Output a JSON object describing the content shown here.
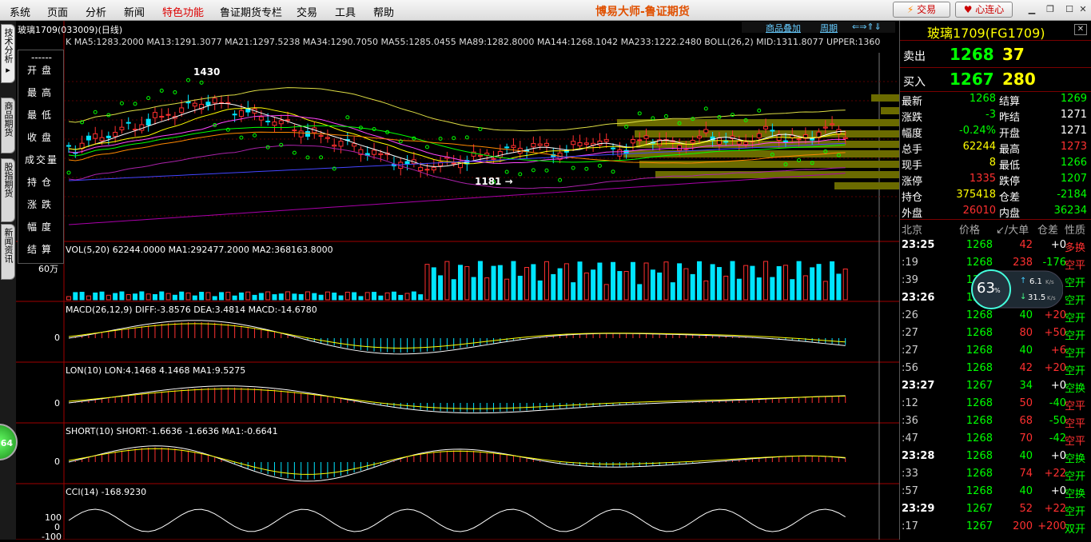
{
  "menu": [
    "系统",
    "页面",
    "分析",
    "新闻",
    "特色功能",
    "鲁证期货专栏",
    "交易",
    "工具",
    "帮助"
  ],
  "menu_special_index": 4,
  "app_title": "博易大师-鲁证期货",
  "toolbar": {
    "trade_label": "交易",
    "xinlian_label": "心连心"
  },
  "left_tabs": [
    "技术分析",
    "商品期货",
    "股指期货",
    "新闻资讯"
  ],
  "indicator_panel": [
    "------",
    "开盘",
    "最高",
    "最低",
    "收盘",
    "成交量",
    "持仓",
    "涨跌",
    "幅度",
    "结算"
  ],
  "chart": {
    "header_title": "玻璃1709(033009)(日线)",
    "ma_text": "K  MA5:1283.2000 MA13:1291.3077 MA21:1297.5238 MA34:1290.7050 MA55:1285.0455 MA89:1282.8000 MA144:1268.1042 MA233:1222.2480 BOLL(26,2) MID:1311.8077 UPPER:1360",
    "right_tools": [
      "商品叠加",
      "周期"
    ],
    "label_high": "1430",
    "label_low": "1181 →",
    "vol_title": "VOL(5,20)  62244.0000  MA1:292477.2000  MA2:368163.8000",
    "vol_axis": "60万",
    "macd_title": "MACD(26,12,9)  DIFF:-3.8576  DEA:3.4814  MACD:-14.6780",
    "lon_title": "LON(10)  LON:4.1468  4.1468  MA1:9.5275",
    "short_title": "SHORT(10)  SHORT:-1.6636  -1.6636  MA1:-0.6641",
    "cci_title": "CCI(14)  -168.9230",
    "zero": "0",
    "cci_ticks": [
      "100",
      "0",
      "-100"
    ]
  },
  "quote": {
    "title": "玻璃1709(FG1709)",
    "sell_label": "卖出",
    "sell_price": "1268",
    "sell_vol": "37",
    "buy_label": "买入",
    "buy_price": "1267",
    "buy_vol": "280",
    "stats": [
      [
        "最新",
        "1268",
        "结算",
        "1269"
      ],
      [
        "涨跌",
        "-3",
        "昨结",
        "1271"
      ],
      [
        "幅度",
        "-0.24%",
        "开盘",
        "1271"
      ],
      [
        "总手",
        "62244",
        "最高",
        "1273"
      ],
      [
        "现手",
        "8",
        "最低",
        "1266"
      ],
      [
        "涨停",
        "1335",
        "跌停",
        "1207"
      ],
      [
        "持仓",
        "375418",
        "仓差",
        "-2184"
      ],
      [
        "外盘",
        "26010",
        "内盘",
        "36234"
      ]
    ],
    "tick_headers": [
      "北京",
      "价格",
      "↙/大单",
      "仓差",
      "性质"
    ],
    "ticks": [
      [
        "23:25",
        "1268",
        "42",
        "+0",
        "多换"
      ],
      [
        ":19",
        "1268",
        "238",
        "-176",
        "空平"
      ],
      [
        ":39",
        "1268",
        "",
        "",
        "空开"
      ],
      [
        "23:26",
        "1268",
        "",
        "",
        "空开"
      ],
      [
        ":26",
        "1268",
        "40",
        "+20",
        "空开"
      ],
      [
        ":27",
        "1268",
        "80",
        "+50",
        "空开"
      ],
      [
        ":27",
        "1268",
        "40",
        "+6",
        "空开"
      ],
      [
        ":56",
        "1268",
        "42",
        "+20",
        "空开"
      ],
      [
        "23:27",
        "1267",
        "34",
        "+0",
        "空换"
      ],
      [
        ":12",
        "1268",
        "50",
        "-40",
        "空平"
      ],
      [
        ":36",
        "1268",
        "68",
        "-50",
        "空平"
      ],
      [
        ":47",
        "1268",
        "70",
        "-42",
        "空平"
      ],
      [
        "23:28",
        "1268",
        "40",
        "+0",
        "空换"
      ],
      [
        ":33",
        "1268",
        "74",
        "+22",
        "空开"
      ],
      [
        ":57",
        "1268",
        "40",
        "+0",
        "空换"
      ],
      [
        "23:29",
        "1267",
        "52",
        "+22",
        "空开"
      ],
      [
        ":17",
        "1267",
        "200",
        "+200",
        "双开"
      ]
    ],
    "badge_pct": "63",
    "badge_pct_unit": "%",
    "badge_up": "6.1",
    "badge_down": "31.5",
    "badge_unit": "K/s"
  },
  "green_ball_text": "64",
  "colors": {
    "up": "#ff3030",
    "down": "#00e5ff",
    "bg": "#000000",
    "grid": "#7a0000",
    "yellow": "#ffff00",
    "green": "#00ff00"
  }
}
